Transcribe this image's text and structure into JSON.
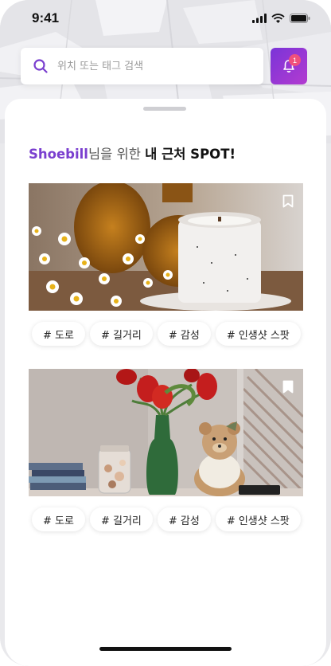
{
  "status_bar": {
    "time": "9:41"
  },
  "search": {
    "placeholder": "위치 또는 태그 검색",
    "value": ""
  },
  "notifications": {
    "badge_count": "1"
  },
  "section": {
    "user_name": "Shoebill",
    "subtitle_suffix": "님을 위한 ",
    "title": "내 근처 SPOT!"
  },
  "spots": [
    {
      "image": "candle-and-chamomile-photo",
      "bookmarked": false,
      "tags": [
        "# 도로",
        "# 길거리",
        "# 감성",
        "# 인생샷 스팟"
      ]
    },
    {
      "image": "tulips-and-teddy-bear-photo",
      "bookmarked": true,
      "tags": [
        "# 도로",
        "# 길거리",
        "# 감성",
        "# 인생샷 스팟"
      ]
    }
  ],
  "colors": {
    "accent": "#7a3fcf",
    "badge": "#f0507c"
  }
}
